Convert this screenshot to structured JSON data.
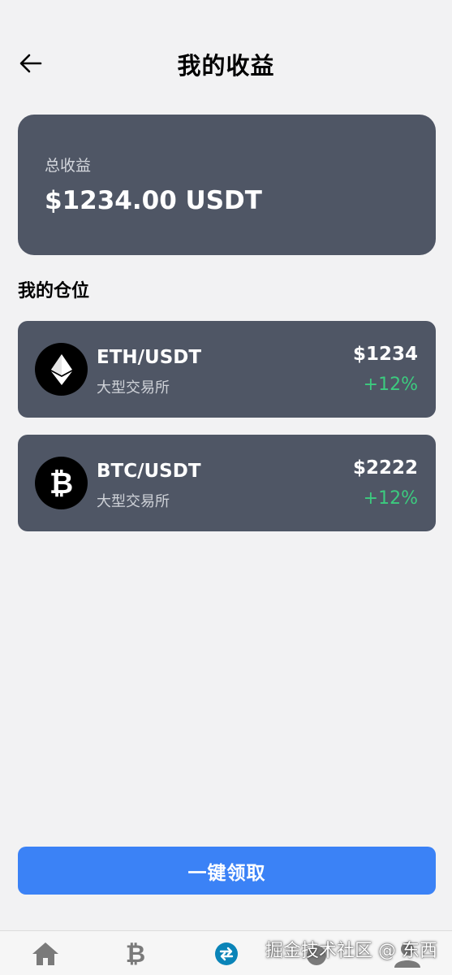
{
  "header": {
    "title": "我的收益"
  },
  "summary": {
    "label": "总收益",
    "value": "$1234.00 USDT"
  },
  "positions_title": "我的仓位",
  "positions": [
    {
      "pair": "ETH/USDT",
      "exchange": "大型交易所",
      "amount": "$1234",
      "change": "+12%",
      "icon": "ethereum-icon"
    },
    {
      "pair": "BTC/USDT",
      "exchange": "大型交易所",
      "amount": "$2222",
      "change": "+12%",
      "icon": "bitcoin-icon"
    }
  ],
  "claim_button": "一键领取",
  "tabbar": {
    "items": [
      {
        "icon": "home-icon"
      },
      {
        "icon": "bitcoin-icon"
      },
      {
        "icon": "swap-icon",
        "active": true
      },
      {
        "icon": "wallet-icon"
      },
      {
        "icon": "profile-icon"
      }
    ]
  },
  "watermark": "掘金技术社区 @ 东西",
  "colors": {
    "card": "#4f5665",
    "accent": "#3b82f6",
    "positive": "#3ccb7f",
    "active_tab": "#0a84b8"
  }
}
